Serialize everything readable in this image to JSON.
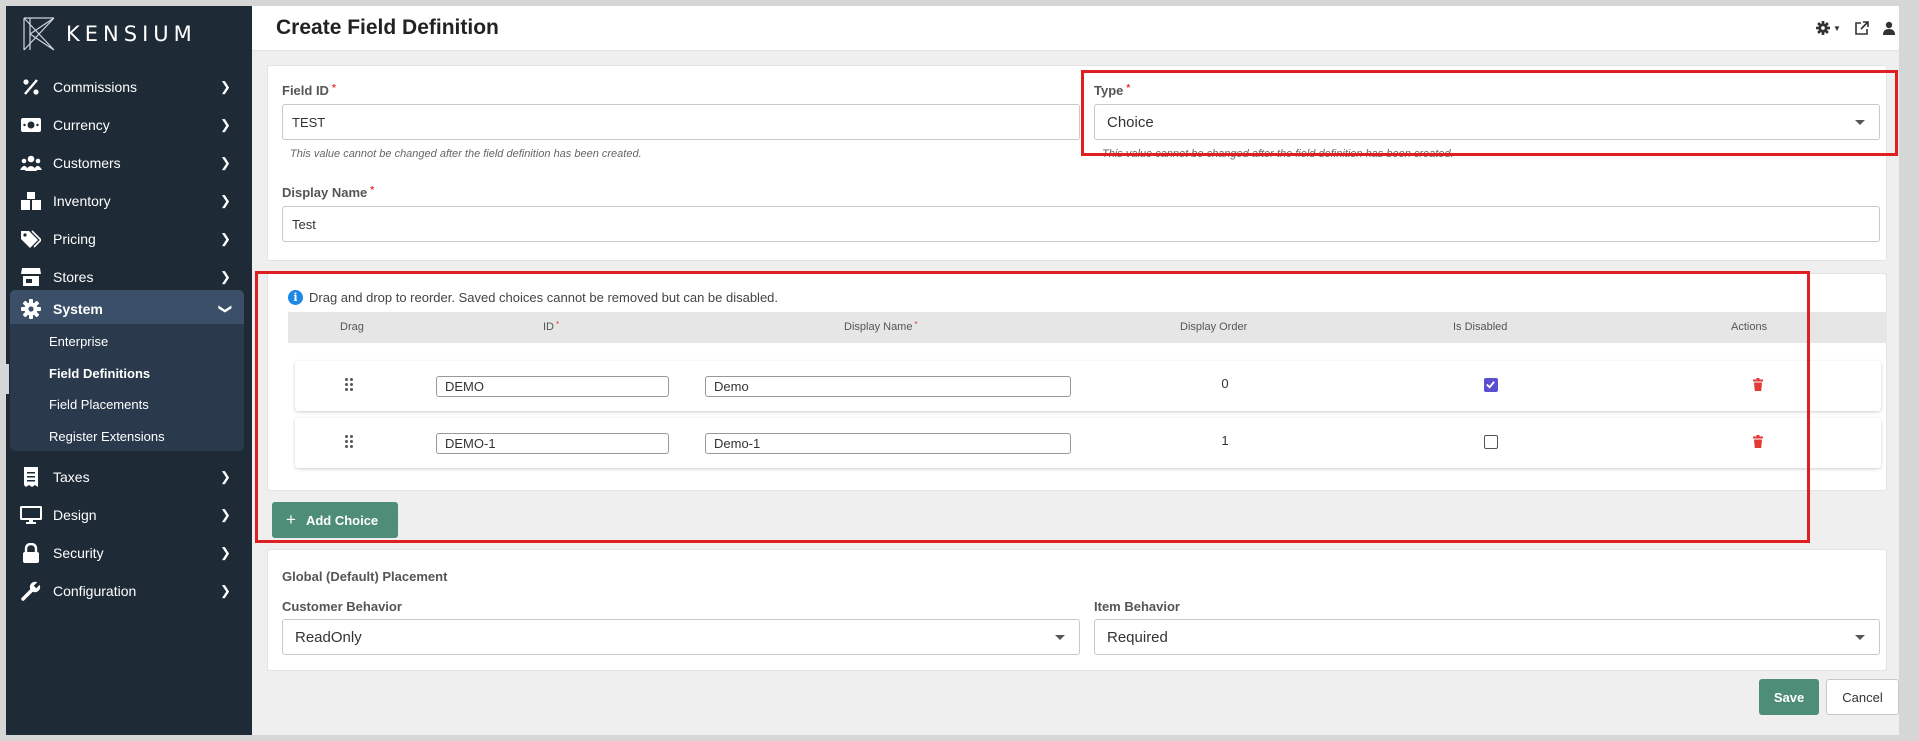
{
  "brand": {
    "name": "KENSIUM"
  },
  "sidebar": {
    "items": [
      {
        "label": "Commissions",
        "icon": "percent-icon"
      },
      {
        "label": "Currency",
        "icon": "money-icon"
      },
      {
        "label": "Customers",
        "icon": "users-icon"
      },
      {
        "label": "Inventory",
        "icon": "boxes-icon"
      },
      {
        "label": "Pricing",
        "icon": "tags-icon"
      },
      {
        "label": "Stores",
        "icon": "store-icon"
      },
      {
        "label": "System",
        "icon": "gear-icon"
      },
      {
        "label": "Taxes",
        "icon": "receipt-icon"
      },
      {
        "label": "Design",
        "icon": "monitor-icon"
      },
      {
        "label": "Security",
        "icon": "lock-icon"
      },
      {
        "label": "Configuration",
        "icon": "wrench-icon"
      }
    ],
    "system_subitems": [
      {
        "label": "Enterprise"
      },
      {
        "label": "Field Definitions"
      },
      {
        "label": "Field Placements"
      },
      {
        "label": "Register Extensions"
      }
    ],
    "active_item": "System",
    "active_subitem": "Field Definitions"
  },
  "header": {
    "title": "Create Field Definition",
    "icons": [
      "gear-dropdown-icon",
      "external-link-icon",
      "user-dropdown-icon"
    ]
  },
  "form": {
    "field_id": {
      "label": "Field ID",
      "value": "TEST",
      "hint": "This value cannot be changed after the field definition has been created."
    },
    "type": {
      "label": "Type",
      "value": "Choice",
      "hint": "This value cannot be changed after the field definition has been created."
    },
    "display_name": {
      "label": "Display Name",
      "value": "Test"
    },
    "required_mark": "*"
  },
  "choices": {
    "info": "Drag and drop to reorder. Saved choices cannot be removed but can be disabled.",
    "columns": {
      "drag": "Drag",
      "id": "ID",
      "display_name": "Display Name",
      "display_order": "Display Order",
      "is_disabled": "Is Disabled",
      "actions": "Actions"
    },
    "rows": [
      {
        "id": "DEMO",
        "display_name": "Demo",
        "display_order": "0",
        "is_disabled": true
      },
      {
        "id": "DEMO-1",
        "display_name": "Demo-1",
        "display_order": "1",
        "is_disabled": false
      }
    ],
    "add_label": "Add Choice"
  },
  "placement": {
    "title": "Global (Default) Placement",
    "customer_behavior": {
      "label": "Customer Behavior",
      "value": "ReadOnly"
    },
    "item_behavior": {
      "label": "Item Behavior",
      "value": "Required"
    }
  },
  "actions": {
    "save": "Save",
    "cancel": "Cancel"
  },
  "colors": {
    "sidebar_bg": "#1e2a36",
    "sidebar_active": "#3b5068",
    "primary_green": "#4e8e78",
    "highlight_red": "#e02020",
    "checkbox_purple": "#5a4fcf",
    "danger_red": "#e53935"
  }
}
